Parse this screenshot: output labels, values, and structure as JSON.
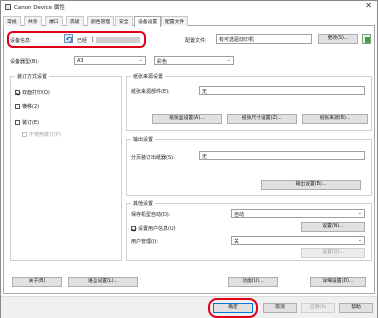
{
  "window": {
    "title": "Canon Device 属性",
    "close_glyph": "✕"
  },
  "tabs": [
    "常规",
    "共享",
    "端口",
    "高级",
    "颜色管理",
    "安全",
    "设备设置",
    "配置文件"
  ],
  "device_info": {
    "label": "设备信息:",
    "status_text": "已经",
    "status_value": "[",
    "config_label": "配置文件:",
    "config_value": "有可选驱动印机",
    "change_button": "更改(S)..."
  },
  "source_row": {
    "label": "设备器型(B):",
    "size_value": "A3",
    "color_value": "彩色"
  },
  "finishing": {
    "title": "装订方式设置",
    "duplex": "双面打印(Q)",
    "staple": "横移(2)",
    "punch": "装订(E)",
    "disabled_option": "不使用装订(P)"
  },
  "paper_source": {
    "title": "纸张来源设置",
    "feed_label": "纸张来源部件(E):",
    "feed_value": "无",
    "btn_details": "纸张盒设置(A)...",
    "btn_size": "纸张尺寸设置(Z)...",
    "btn_source": "纸张来源(B)..."
  },
  "output": {
    "title": "输出设置",
    "tray_label": "分页装订出纸器(S):",
    "tray_value": "无",
    "btn_settings": "输出设置(B)..."
  },
  "other": {
    "title": "其他设置",
    "keep_label": "保存机型自动(D):",
    "keep_value": "自动",
    "user_mgmt": "设置用户信息(U)",
    "user_btn": "设置(N)...",
    "account_label": "用户管理(I):",
    "account_value": "关",
    "account_btn": "设置(Q)..."
  },
  "mid_buttons": {
    "about": "关于(B)",
    "lang": "语言设置(L)...",
    "function": "功能(U)...",
    "detail": "详细设置(D)..."
  },
  "dialog_buttons": {
    "ok": "确定",
    "cancel": "取消",
    "apply": "应用(A)",
    "help": "帮助"
  }
}
